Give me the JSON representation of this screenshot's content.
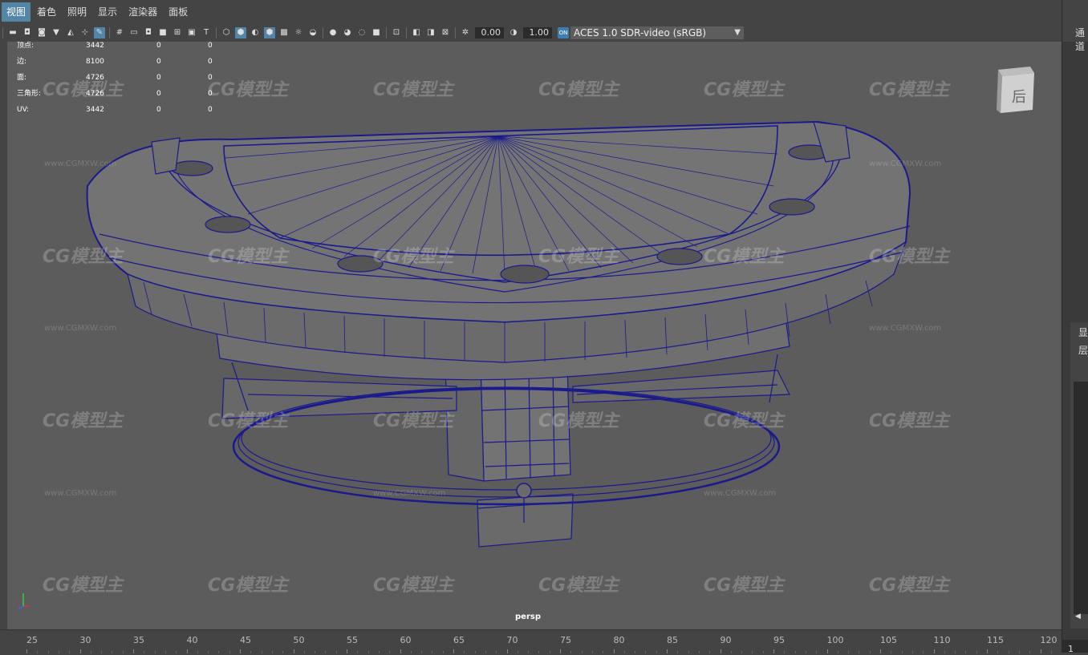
{
  "menu": {
    "items": [
      "视图",
      "着色",
      "照明",
      "显示",
      "渲染器",
      "面板"
    ]
  },
  "toolbar": {
    "exposure": "0.00",
    "gamma": "1.00",
    "color_toggle": "ON",
    "color_space": "ACES 1.0 SDR-video (sRGB)"
  },
  "hud": {
    "rows": [
      {
        "label": "顶点:",
        "v1": "3442",
        "v2": "0",
        "v3": "0"
      },
      {
        "label": "边:",
        "v1": "8100",
        "v2": "0",
        "v3": "0"
      },
      {
        "label": "面:",
        "v1": "4726",
        "v2": "0",
        "v3": "0"
      },
      {
        "label": "三角形:",
        "v1": "4726",
        "v2": "0",
        "v3": "0"
      },
      {
        "label": "UV:",
        "v1": "3442",
        "v2": "0",
        "v3": "0"
      }
    ]
  },
  "viewport": {
    "camera": "persp",
    "viewcube_face": "后",
    "watermark": "CG模型主",
    "watermark_url": "www.CGMXW.com"
  },
  "right_panel": {
    "channel_tab": "通道",
    "display_tab": "显",
    "layer_tab": "层",
    "current_frame": "1"
  },
  "timeline": {
    "labels": [
      "25",
      "30",
      "35",
      "40",
      "45",
      "50",
      "55",
      "60",
      "65",
      "70",
      "75",
      "80",
      "85",
      "90",
      "95",
      "100",
      "105",
      "110",
      "115",
      "120"
    ]
  },
  "colors": {
    "viewport_bg": "#5c5c5c",
    "wireframe": "#1a1a8c",
    "mesh": "#707070",
    "accent": "#5285a6"
  }
}
